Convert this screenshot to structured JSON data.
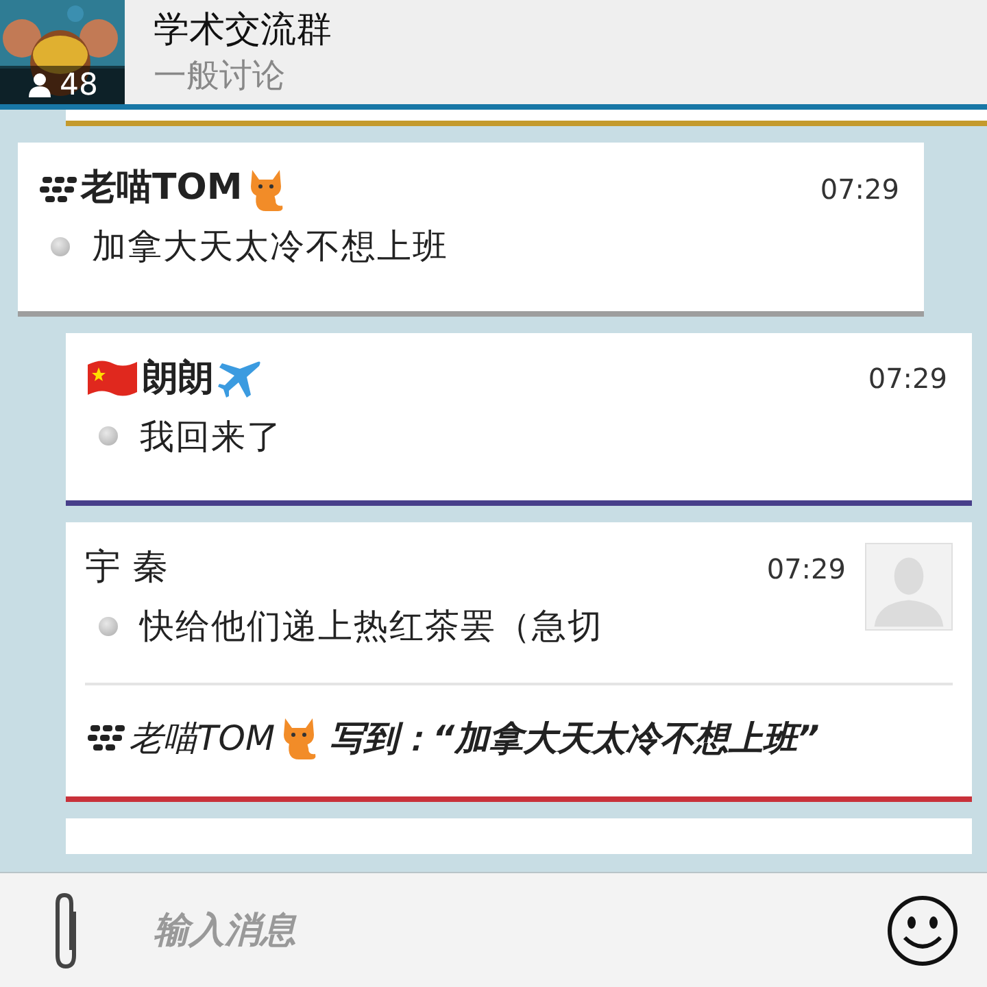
{
  "header": {
    "member_count": "48",
    "title": "学术交流群",
    "subtitle": "一般讨论"
  },
  "messages": [
    {
      "kind": "partial",
      "color": "#c49a2c"
    },
    {
      "kind": "left",
      "color": "#9e9e9e",
      "sender": "老喵TOM",
      "bold": true,
      "time": "07:29",
      "text": "加拿大天太冷不想上班"
    },
    {
      "kind": "right",
      "color": "#483f8a",
      "sender": "朗朗",
      "bold": true,
      "time": "07:29",
      "text": "我回来了"
    },
    {
      "kind": "right",
      "color": "#c8313a",
      "sender": "宇 秦",
      "bold": false,
      "time": "07:29",
      "text": "快给他们递上热红茶罢（急切",
      "avatar": true,
      "quote": {
        "sender": "老喵TOM",
        "text": "写到：“加拿大天太冷不想上班”"
      }
    },
    {
      "kind": "right_partial",
      "color": "#ffffff"
    }
  ],
  "composer": {
    "placeholder": "输入消息"
  }
}
